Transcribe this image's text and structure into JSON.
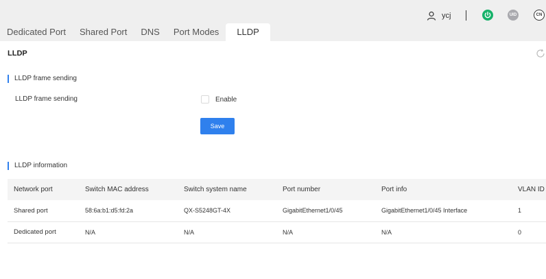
{
  "header": {
    "username": "ycj",
    "uid_label": "UID",
    "lang_label": "CN",
    "colors": {
      "power": "#17b26a",
      "uid": "#a9a9ae",
      "accent": "#2f80ed"
    }
  },
  "tabs": [
    {
      "label": "Dedicated Port"
    },
    {
      "label": "Shared Port"
    },
    {
      "label": "DNS"
    },
    {
      "label": "Port Modes"
    },
    {
      "label": "LLDP"
    }
  ],
  "page": {
    "title": "LLDP",
    "frame_section_title": "LLDP frame sending",
    "frame_label": "LLDP frame sending",
    "enable_label": "Enable",
    "save_label": "Save",
    "info_section_title": "LLDP information"
  },
  "table": {
    "headers": [
      "Network port",
      "Switch MAC address",
      "Switch system name",
      "Port number",
      "Port info",
      "VLAN ID"
    ],
    "rows": [
      [
        "Shared port",
        "58:6a:b1:d5:fd:2a",
        "QX-S5248GT-4X",
        "GigabitEthernet1/0/45",
        "GigabitEthernet1/0/45 Interface",
        "1"
      ],
      [
        "Dedicated port",
        "N/A",
        "N/A",
        "N/A",
        "N/A",
        "0"
      ]
    ]
  }
}
